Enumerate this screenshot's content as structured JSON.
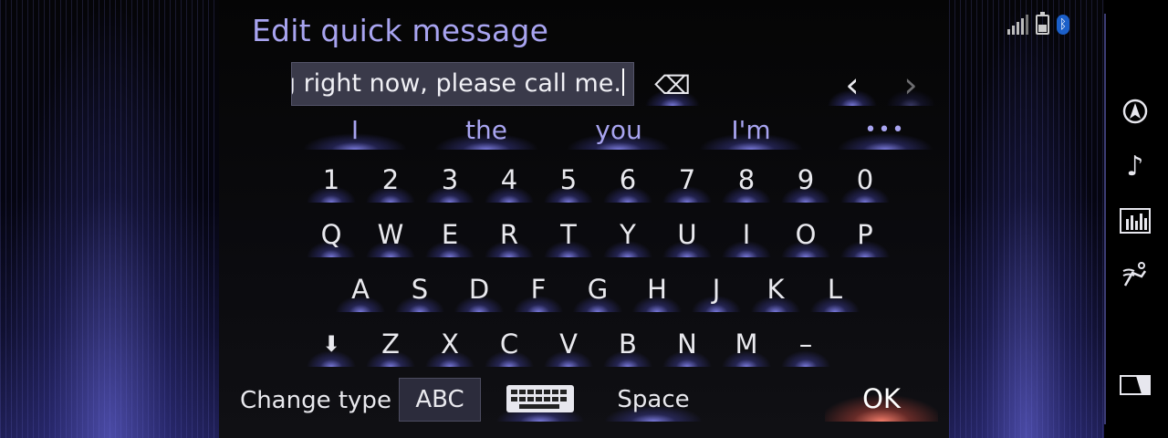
{
  "screen": {
    "title": "Edit quick message"
  },
  "message_field": {
    "value": "ng right now, please call me."
  },
  "suggestions": [
    "I",
    "the",
    "you",
    "I'm",
    "•••"
  ],
  "keyboard": {
    "numbers": [
      "1",
      "2",
      "3",
      "4",
      "5",
      "6",
      "7",
      "8",
      "9",
      "0"
    ],
    "row1": [
      "Q",
      "W",
      "E",
      "R",
      "T",
      "Y",
      "U",
      "I",
      "O",
      "P"
    ],
    "row2": [
      "A",
      "S",
      "D",
      "F",
      "G",
      "H",
      "J",
      "K",
      "L"
    ],
    "row3": [
      "Z",
      "X",
      "C",
      "V",
      "B",
      "N",
      "M",
      "–"
    ]
  },
  "bottom_bar": {
    "change_type_label": "Change type",
    "mode_label": "ABC",
    "space_label": "Space",
    "ok_label": "OK"
  },
  "glyphs": {
    "backspace": "⌫",
    "cursor_left": "‹",
    "cursor_right": "›",
    "shift": "⬇",
    "music": "♪"
  },
  "colors": {
    "accent": "#a8a4f0",
    "ok_glow": "#ff826e",
    "bluetooth": "#1b5fc9"
  },
  "icons": {
    "status": [
      "signal-icon",
      "battery-icon",
      "bluetooth-icon"
    ],
    "nav": [
      "navigation-icon",
      "music-icon",
      "equalizer-icon",
      "climate-icon",
      "display-icon"
    ]
  }
}
